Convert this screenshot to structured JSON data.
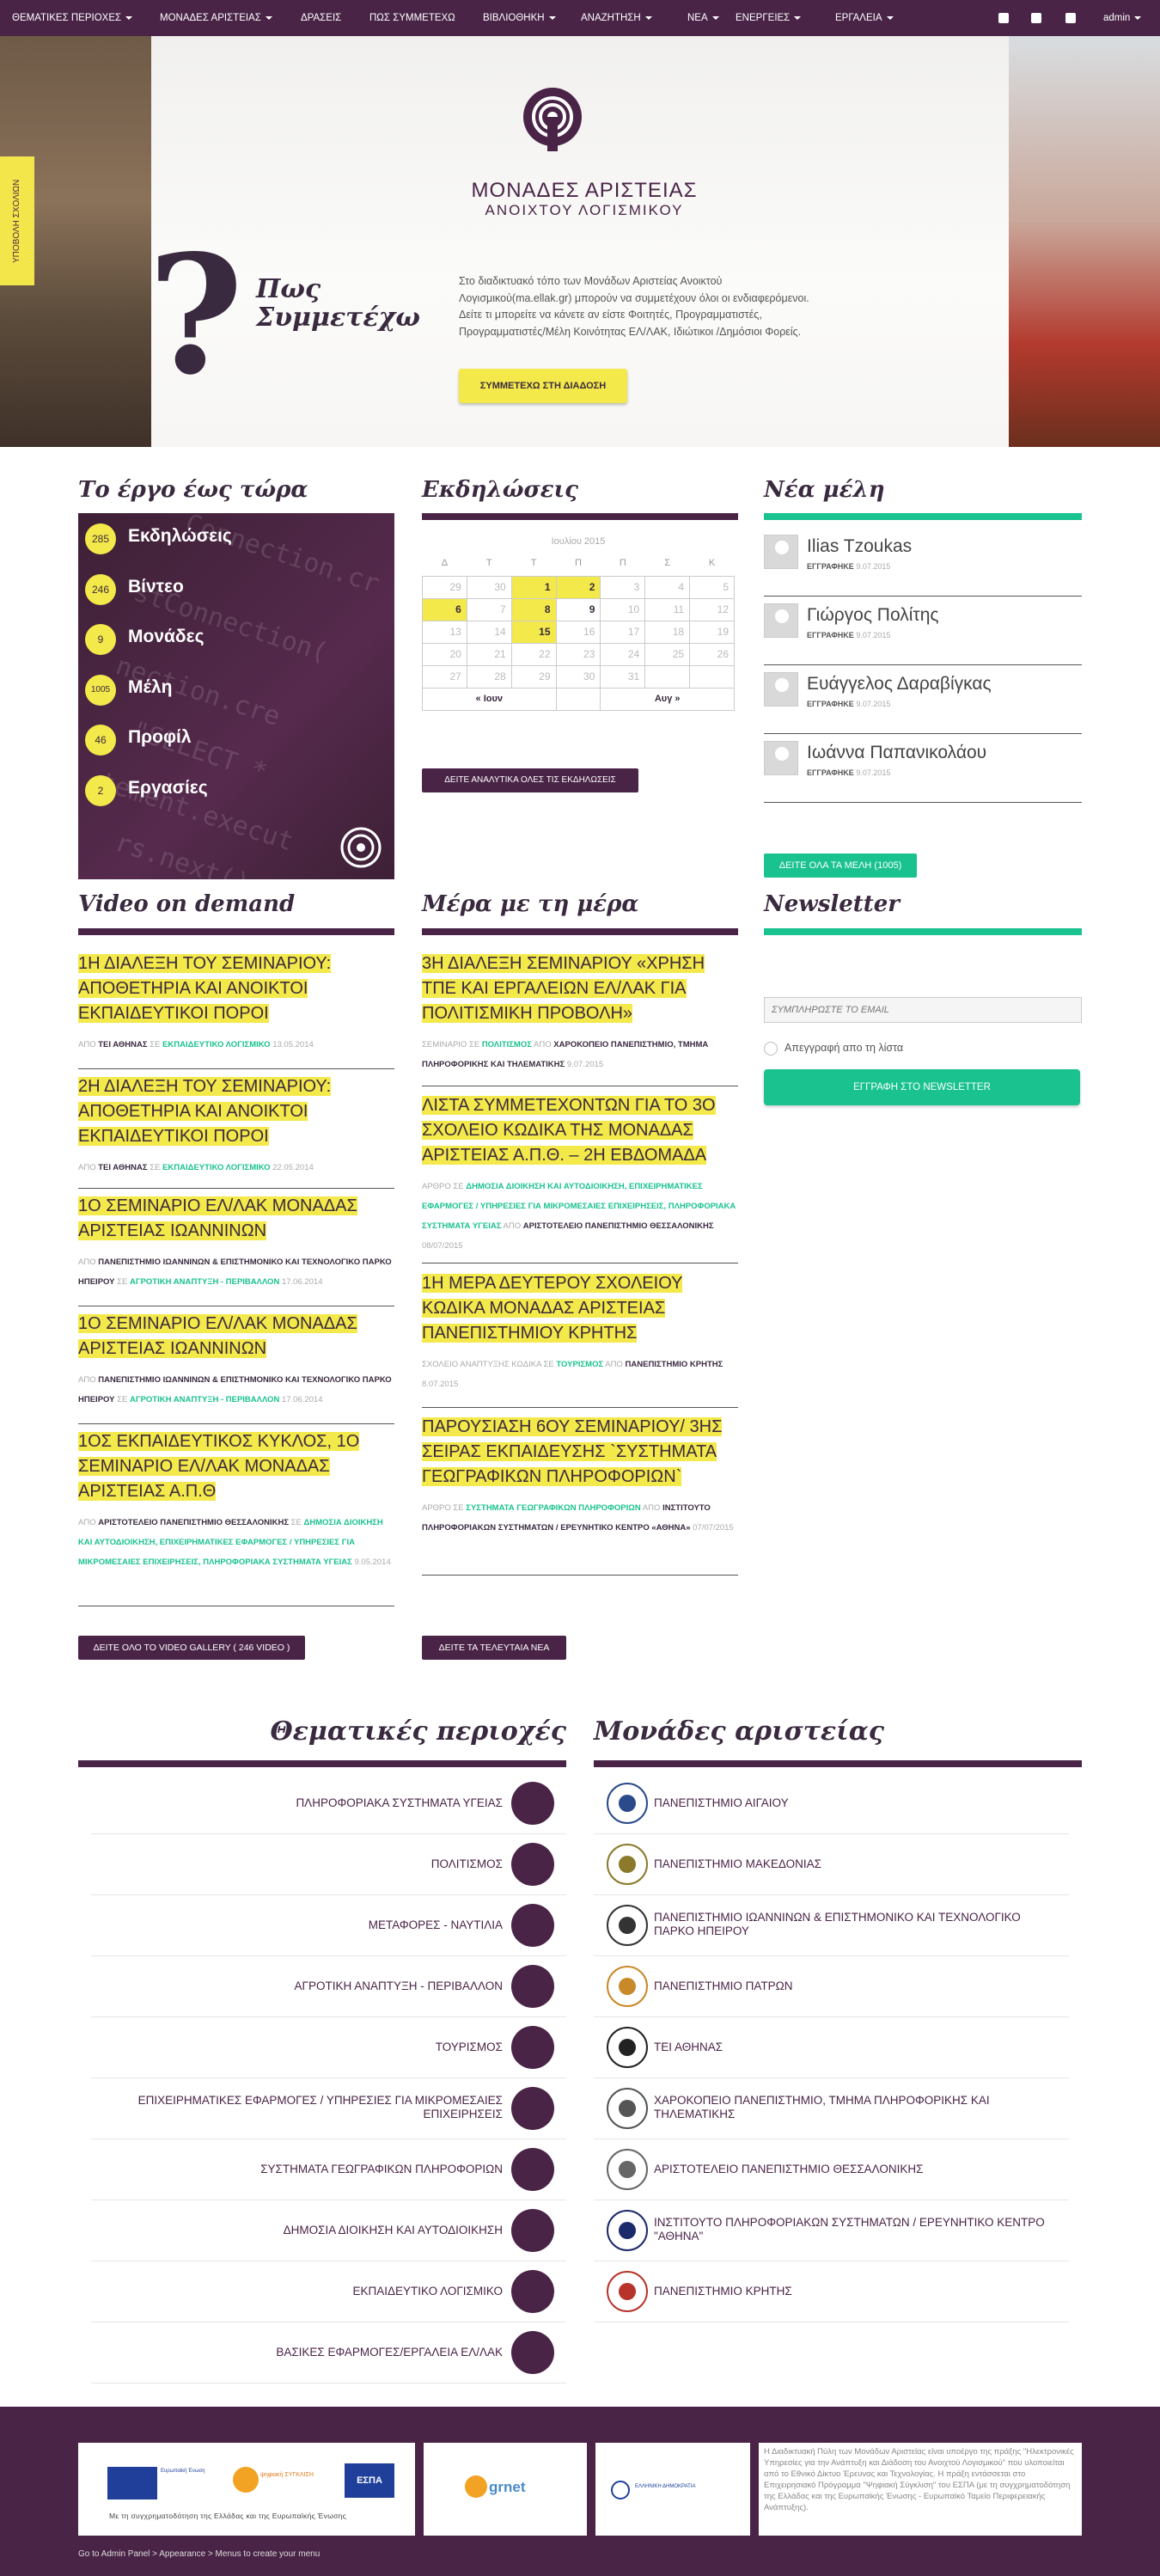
{
  "nav": {
    "items": [
      {
        "label": "ΘΕΜΑΤΙΚΕΣ ΠΕΡΙΟΧΕΣ",
        "dropdown": true
      },
      {
        "label": "ΜΟΝΑΔΕΣ ΑΡΙΣΤΕΙΑΣ",
        "dropdown": true
      },
      {
        "label": "ΔΡΑΣΕΙΣ",
        "dropdown": false
      },
      {
        "label": "ΠΩΣ ΣΥΜΜΕΤΕΧΩ",
        "dropdown": false
      },
      {
        "label": "ΒΙΒΛΙΟΘΗΚΗ",
        "dropdown": true
      },
      {
        "label": "ΑΝΑΖΗΤΗΣΗ",
        "dropdown": true
      },
      {
        "label": "ΝΕΑ",
        "dropdown": true
      },
      {
        "label": "ΕΝΕΡΓΕΙΕΣ",
        "dropdown": true
      },
      {
        "label": "ΕΡΓΑΛΕΙΑ",
        "dropdown": true
      }
    ],
    "social_icons": [
      "facebook-icon",
      "twitter-icon",
      "rss-icon"
    ],
    "user": "admin"
  },
  "hero": {
    "side_tab": "ΥΠΟΒΟΛΗ ΣΧΟΛΙΩΝ",
    "logo_line1": "ΜΟΝΑΔΕΣ ΑΡΙΣΤΕΙΑΣ",
    "logo_line2": "ΑΝΟΙΧΤΟΥ ΛΟΓΙΣΜΙΚΟΥ",
    "qmark": "?",
    "heading_line1": "Πως",
    "heading_line2": "Συμμετέχω",
    "desc_lines": [
      "Στο διαδικτυακό τόπο των Μονάδων Αριστείας Ανοικτού",
      "Λογισμικού(ma.ellak.gr) μπορούν να συμμετέχουν όλοι οι ενδιαφερόμενοι.",
      "Δείτε τι μπορείτε να κάνετε αν είστε Φοιτητές, Προγραμματιστές,",
      "Προγραμματιστές/Μέλη Κοινότητας ΕΛ/ΛΑΚ, Ιδιώτικοι /Δημόσιοι Φορείς."
    ],
    "cta": "ΣΥΜΜΕΤΕΧΩ ΣΤΗ ΔΙΑΔΟΣΗ"
  },
  "work": {
    "title": "Το έργο έως τώρα",
    "stats": [
      {
        "count": "285",
        "label": "Εκδηλώσεις"
      },
      {
        "count": "246",
        "label": "Βίντεο"
      },
      {
        "count": "9",
        "label": "Μονάδες"
      },
      {
        "count": "1005",
        "label": "Μέλη"
      },
      {
        "count": "46",
        "label": "Προφίλ"
      },
      {
        "count": "2",
        "label": "Εργασίες"
      }
    ]
  },
  "events": {
    "title": "Εκδηλώσεις",
    "month": "Ιουλίου 2015",
    "weekdays": [
      "Δ",
      "Τ",
      "Τ",
      "Π",
      "Π",
      "Σ",
      "Κ"
    ],
    "weeks": [
      [
        {
          "d": "29",
          "s": "muted"
        },
        {
          "d": "30",
          "s": "muted"
        },
        {
          "d": "1",
          "s": "hl"
        },
        {
          "d": "2",
          "s": "hl"
        },
        {
          "d": "3",
          "s": "muted"
        },
        {
          "d": "4",
          "s": "muted"
        },
        {
          "d": "5",
          "s": "muted"
        }
      ],
      [
        {
          "d": "6",
          "s": "hl"
        },
        {
          "d": "7",
          "s": "muted"
        },
        {
          "d": "8",
          "s": "hl"
        },
        {
          "d": "9",
          "s": "act"
        },
        {
          "d": "10",
          "s": "muted"
        },
        {
          "d": "11",
          "s": "muted"
        },
        {
          "d": "12",
          "s": "muted"
        }
      ],
      [
        {
          "d": "13",
          "s": "muted"
        },
        {
          "d": "14",
          "s": "muted"
        },
        {
          "d": "15",
          "s": "hl"
        },
        {
          "d": "16",
          "s": "muted"
        },
        {
          "d": "17",
          "s": "muted"
        },
        {
          "d": "18",
          "s": "muted"
        },
        {
          "d": "19",
          "s": "muted"
        }
      ],
      [
        {
          "d": "20",
          "s": "muted"
        },
        {
          "d": "21",
          "s": "muted"
        },
        {
          "d": "22",
          "s": "muted"
        },
        {
          "d": "23",
          "s": "muted"
        },
        {
          "d": "24",
          "s": "muted"
        },
        {
          "d": "25",
          "s": "muted"
        },
        {
          "d": "26",
          "s": "muted"
        }
      ],
      [
        {
          "d": "27",
          "s": "muted"
        },
        {
          "d": "28",
          "s": "muted"
        },
        {
          "d": "29",
          "s": "muted"
        },
        {
          "d": "30",
          "s": "muted"
        },
        {
          "d": "31",
          "s": "muted"
        },
        {
          "d": "",
          "s": "muted"
        },
        {
          "d": "",
          "s": "muted"
        }
      ]
    ],
    "prev": "« Ιουν",
    "next": "Αυγ »",
    "all_button": "ΔΕΙΤΕ ΑΝΑΛΥΤΙΚΑ ΟΛΕΣ ΤΙΣ ΕΚΔΗΛΩΣΕΙΣ"
  },
  "members": {
    "title": "Νέα μέλη",
    "list": [
      {
        "name": "Ilias Tzoukas",
        "label": "ΕΓΓΡΑΦΗΚΕ",
        "date": "9.07.2015"
      },
      {
        "name": "Γιώργος Πολίτης",
        "label": "ΕΓΓΡΑΦΗΚΕ",
        "date": "9.07.2015"
      },
      {
        "name": "Ευάγγελος Δαραβίγκας",
        "label": "ΕΓΓΡΑΦΗΚΕ",
        "date": "9.07.2015"
      },
      {
        "name": "Ιωάννα Παπανικολάου",
        "label": "ΕΓΓΡΑΦΗΚΕ",
        "date": "9.07.2015"
      }
    ],
    "all_button": "ΔΕΙΤΕ ΟΛΑ ΤΑ ΜΕΛΗ (1005)"
  },
  "video": {
    "title": "Video on demand",
    "posts": [
      {
        "lines": [
          "1Η ΔΙΑΛΕΞΗ ΤΟΥ ΣΕΜΙΝΑΡΙΟΥ:",
          "ΑΠΟΘΕΤΗΡΙΑ ΚΑΙ ΑΝΟΙΚΤΟΙ",
          "ΕΚΠΑΙΔΕΥΤΙΚΟΙ ΠΟΡΟΙ"
        ],
        "meta": [
          "ΑΠΟ ",
          "ΤΕΙ ΑΘΗΝΑΣ",
          " ΣΕ ",
          "ΕΚΠΑΙΔΕΥΤΙΚΟ ΛΟΓΙΣΜΙΚΟ",
          " 13.05.2014"
        ]
      },
      {
        "lines": [
          "2Η ΔΙΑΛΕΞΗ ΤΟΥ ΣΕΜΙΝΑΡΙΟΥ:",
          "ΑΠΟΘΕΤΗΡΙΑ ΚΑΙ ΑΝΟΙΚΤΟΙ",
          "ΕΚΠΑΙΔΕΥΤΙΚΟΙ ΠΟΡΟΙ"
        ],
        "meta": [
          "ΑΠΟ ",
          "ΤΕΙ ΑΘΗΝΑΣ",
          " ΣΕ ",
          "ΕΚΠΑΙΔΕΥΤΙΚΟ ΛΟΓΙΣΜΙΚΟ",
          " 22.05.2014"
        ]
      },
      {
        "lines": [
          "1Ο ΣΕΜΙΝΑΡΙΟ ΕΛ/ΛΑΚ ΜΟΝΑΔΑΣ",
          "ΑΡΙΣΤΕΙΑΣ ΙΩΑΝΝΙΝΩΝ"
        ],
        "meta": [
          "ΑΠΟ ",
          "ΠΑΝΕΠΙΣΤΗΜΙΟ ΙΩΑΝΝΙΝΩΝ & ΕΠΙΣΤΗΜΟΝΙΚΟ ΚΑΙ ΤΕΧΝΟΛΟΓΙΚΟ ΠΑΡΚΟ ΗΠΕΙΡΟΥ",
          " ΣΕ ",
          "ΑΓΡΟΤΙΚΗ ΑΝΑΠΤΥΞΗ - ΠΕΡΙΒΑΛΛΟΝ",
          " 17.06.2014"
        ]
      },
      {
        "lines": [
          "1Ο ΣΕΜΙΝΑΡΙΟ ΕΛ/ΛΑΚ ΜΟΝΑΔΑΣ",
          "ΑΡΙΣΤΕΙΑΣ ΙΩΑΝΝΙΝΩΝ"
        ],
        "meta": [
          "ΑΠΟ ",
          "ΠΑΝΕΠΙΣΤΗΜΙΟ ΙΩΑΝΝΙΝΩΝ & ΕΠΙΣΤΗΜΟΝΙΚΟ ΚΑΙ ΤΕΧΝΟΛΟΓΙΚΟ ΠΑΡΚΟ ΗΠΕΙΡΟΥ",
          " ΣΕ ",
          "ΑΓΡΟΤΙΚΗ ΑΝΑΠΤΥΞΗ - ΠΕΡΙΒΑΛΛΟΝ",
          " 17.06.2014"
        ]
      },
      {
        "lines": [
          "1ΟΣ ΕΚΠΑΙΔΕΥΤΙΚΟΣ ΚΥΚΛΟΣ, 1Ο",
          "ΣΕΜΙΝΑΡΙΟ ΕΛ/ΛΑΚ ΜΟΝΑΔΑΣ",
          "ΑΡΙΣΤΕΙΑΣ Α.Π.Θ"
        ],
        "meta": [
          "ΑΠΟ ",
          "ΑΡΙΣΤΟΤΕΛΕΙΟ ΠΑΝΕΠΙΣΤΗΜΙΟ ΘΕΣΣΑΛΟΝΙΚΗΣ",
          " ΣΕ ",
          "ΔΗΜΟΣΙΑ ΔΙΟΙΚΗΣΗ ΚΑΙ ΑΥΤΟΔΙΟΙΚΗΣΗ, ΕΠΙΧΕΙΡΗΜΑΤΙΚΕΣ ΕΦΑΡΜΟΓΕΣ / ΥΠΗΡΕΣΙΕΣ ΓΙΑ ΜΙΚΡΟΜΕΣΑΙΕΣ ΕΠΙΧΕΙΡΗΣΕΙΣ, ΠΛΗΡΟΦΟΡΙΑΚΑ ΣΥΣΤΗΜΑΤΑ ΥΓΕΙΑΣ",
          " 9.05.2014"
        ]
      }
    ],
    "all_button": "ΔΕΙΤΕ ΟΛΟ ΤΟ VIDEO GALLERY ( 246 VIDEO )"
  },
  "daily": {
    "title": "Μέρα με τη μέρα",
    "posts": [
      {
        "lines": [
          "3Η ΔΙΑΛΕΞΗ ΣΕΜΙΝΑΡΙΟΥ «ΧΡΗΣΗ",
          "ΤΠΕ ΚΑΙ ΕΡΓΑΛΕΙΩΝ ΕΛ/ΛΑΚ ΓΙΑ",
          "ΠΟΛΙΤΙΣΜΙΚΗ ΠΡΟΒΟΛΗ»"
        ],
        "meta": [
          "ΣΕΜΙΝΑΡΙΟ ΣΕ ",
          "ΠΟΛΙΤΙΣΜΟΣ",
          " ΑΠΟ ",
          "ΧΑΡΟΚΟΠΕΙΟ ΠΑΝΕΠΙΣΤΗΜΙΟ, ΤΜΗΜΑ ΠΛΗΡΟΦΟΡΙΚΗΣ ΚΑΙ ΤΗΛΕΜΑΤΙΚΗΣ",
          " 9.07.2015"
        ]
      },
      {
        "lines": [
          "ΛΙΣΤΑ ΣΥΜΜΕΤΕΧΟΝΤΩΝ ΓΙΑ ΤΟ 3Ο",
          "ΣΧΟΛΕΙΟ ΚΩΔΙΚΑ ΤΗΣ ΜΟΝΑΔΑΣ",
          "ΑΡΙΣΤΕΙΑΣ Α.Π.Θ. – 2Η ΕΒΔΟΜΑΔΑ"
        ],
        "meta": [
          "ΑΡΘΡΟ ΣΕ ",
          "ΔΗΜΟΣΙΑ ΔΙΟΙΚΗΣΗ ΚΑΙ ΑΥΤΟΔΙΟΙΚΗΣΗ, ΕΠΙΧΕΙΡΗΜΑΤΙΚΕΣ ΕΦΑΡΜΟΓΕΣ / ΥΠΗΡΕΣΙΕΣ ΓΙΑ ΜΙΚΡΟΜΕΣΑΙΕΣ ΕΠΙΧΕΙΡΗΣΕΙΣ, ΠΛΗΡΟΦΟΡΙΑΚΑ ΣΥΣΤΗΜΑΤΑ ΥΓΕΙΑΣ",
          " ΑΠΟ ",
          "ΑΡΙΣΤΟΤΕΛΕΙΟ ΠΑΝΕΠΙΣΤΗΜΙΟ ΘΕΣΣΑΛΟΝΙΚΗΣ",
          " 08/07/2015"
        ]
      },
      {
        "lines": [
          "1Η ΜΕΡΑ ΔΕΥΤΕΡΟΥ ΣΧΟΛΕΙΟΥ",
          "ΚΩΔΙΚΑ ΜΟΝΑΔΑΣ ΑΡΙΣΤΕΙΑΣ",
          "ΠΑΝΕΠΙΣΤΗΜΙΟΥ ΚΡΗΤΗΣ"
        ],
        "meta": [
          "ΣΧΟΛΕΙΟ ΑΝΑΠΤΥΞΗΣ ΚΩΔΙΚΑ ΣΕ ",
          "ΤΟΥΡΙΣΜΟΣ",
          " ΑΠΟ ",
          "ΠΑΝΕΠΙΣΤΗΜΙΟ ΚΡΗΤΗΣ",
          " 8.07.2015"
        ]
      },
      {
        "lines": [
          "ΠΑΡΟΥΣΙΑΣΗ 6ΟΥ ΣΕΜΙΝΑΡΙΟΥ/ 3ΗΣ",
          "ΣΕΙΡΑΣ ΕΚΠΑΙΔΕΥΣΗΣ `ΣΥΣΤΗΜΑΤΑ",
          "ΓΕΩΓΡΑΦΙΚΩΝ ΠΛΗΡΟΦΟΡΙΩΝ`"
        ],
        "meta": [
          "ΑΡΘΡΟ ΣΕ ",
          "ΣΥΣΤΗΜΑΤΑ ΓΕΩΓΡΑΦΙΚΩΝ ΠΛΗΡΟΦΟΡΙΩΝ",
          " ΑΠΟ ",
          "ΙΝΣΤΙΤΟΥΤΟ ΠΛΗΡΟΦΟΡΙΑΚΩΝ ΣΥΣΤΗΜΑΤΩΝ / ΕΡΕΥΝΗΤΙΚΟ ΚΕΝΤΡΟ «ΑΘΗΝΑ»",
          " 07/07/2015"
        ]
      }
    ],
    "all_button": "ΔΕΙΤΕ ΤΑ ΤΕΛΕΥΤΑΙΑ ΝΕΑ"
  },
  "newsletter": {
    "title": "Newsletter",
    "placeholder": "ΣΥΜΠΛΗΡΩΣΤΕ ΤΟ EMAIL",
    "unsubscribe": "Απεγγραφή απο τη λίστα",
    "button": "ΕΓΓΡΑΦΗ ΣΤΟ NEWSLETTER"
  },
  "themes": {
    "title": "Θεματικές περιοχές",
    "items": [
      {
        "label": "ΠΛΗΡΟΦΟΡΙΑΚΑ ΣΥΣΤΗΜΑΤΑ ΥΓΕΙΑΣ",
        "icon": "health-cross-icon"
      },
      {
        "label": "ΠΟΛΙΤΙΣΜΟΣ",
        "icon": "theater-masks-icon"
      },
      {
        "label": "ΜΕΤΑΦΟΡΕΣ - ΝΑΥΤΙΛΙΑ",
        "icon": "ship-icon"
      },
      {
        "label": "ΑΓΡΟΤΙΚΗ ΑΝΑΠΤΥΞΗ - ΠΕΡΙΒΑΛΛΟΝ",
        "icon": "wheat-icon"
      },
      {
        "label": "ΤΟΥΡΙΣΜΟΣ",
        "icon": "luggage-icon"
      },
      {
        "label": "ΕΠΙΧΕΙΡΗΜΑΤΙΚΕΣ ΕΦΑΡΜΟΓΕΣ / ΥΠΗΡΕΣΙΕΣ ΓΙΑ ΜΙΚΡΟΜΕΣΑΙΕΣ ΕΠΙΧΕΙΡΗΣΕΙΣ",
        "icon": "presentation-icon"
      },
      {
        "label": "ΣΥΣΤΗΜΑΤΑ ΓΕΩΓΡΑΦΙΚΩΝ ΠΛΗΡΟΦΟΡΙΩΝ",
        "icon": "globe-icon"
      },
      {
        "label": "ΔΗΜΟΣΙΑ ΔΙΟΙΚΗΣΗ ΚΑΙ ΑΥΤΟΔΙΟΙΚΗΣΗ",
        "icon": "building-icon"
      },
      {
        "label": "ΕΚΠΑΙΔΕΥΤΙΚΟ ΛΟΓΙΣΜΙΚΟ",
        "icon": "owl-icon"
      },
      {
        "label": "ΒΑΣΙΚΕΣ ΕΦΑΡΜΟΓΕΣ/ΕΡΓΑΛΕΙΑ ΕΛ/ΛΑΚ",
        "icon": "oss-icon"
      }
    ]
  },
  "units": {
    "title": "Μονάδες αριστείας",
    "items": [
      {
        "label": "ΠΑΝΕΠΙΣΤΗΜΙΟ ΑΙΓΑΙΟΥ",
        "color": "#2a4a8a"
      },
      {
        "label": "ΠΑΝΕΠΙΣΤΗΜΙΟ ΜΑΚΕΔΟΝΙΑΣ",
        "color": "#8a7a2a"
      },
      {
        "label": "ΠΑΝΕΠΙΣΤΗΜΙΟ ΙΩΑΝΝΙΝΩΝ & ΕΠΙΣΤΗΜΟΝΙΚΟ ΚΑΙ ΤΕΧΝΟΛΟΓΙΚΟ ΠΑΡΚΟ ΗΠΕΙΡΟΥ",
        "color": "#333333"
      },
      {
        "label": "ΠΑΝΕΠΙΣΤΗΜΙΟ ΠΑΤΡΩΝ",
        "color": "#c8892a"
      },
      {
        "label": "ΤΕΙ ΑΘΗΝΑΣ",
        "color": "#222222"
      },
      {
        "label": "ΧΑΡΟΚΟΠΕΙΟ ΠΑΝΕΠΙΣΤΗΜΙΟ, ΤΜΗΜΑ ΠΛΗΡΟΦΟΡΙΚΗΣ ΚΑΙ ΤΗΛΕΜΑΤΙΚΗΣ",
        "color": "#555555"
      },
      {
        "label": "ΑΡΙΣΤΟΤΕΛΕΙΟ ΠΑΝΕΠΙΣΤΗΜΙΟ ΘΕΣΣΑΛΟΝΙΚΗΣ",
        "color": "#666666"
      },
      {
        "label": "ΙΝΣΤΙΤΟΥΤΟ ΠΛΗΡΟΦΟΡΙΑΚΩΝ ΣΥΣΤΗΜΑΤΩΝ / ΕΡΕΥΝΗΤΙΚΟ ΚΕΝΤΡΟ \"ΑΘΗΝΑ\"",
        "color": "#1a2a6a"
      },
      {
        "label": "ΠΑΝΕΠΙΣΤΗΜΙΟ ΚΡΗΤΗΣ",
        "color": "#b8342a"
      }
    ]
  },
  "footer": {
    "cofinance": "Με τη συγχρηματοδότηση της Ελλάδας και της Ευρωπαϊκής Ένωσης",
    "eu_label": "Ευρωπαϊκή Ένωση",
    "digital_label": "ψηφιακή ΣΥΓΚΛΙΣΗ",
    "espa_label": "ΕΣΠΑ",
    "grnet_label": "grnet",
    "ministry_label": "ΕΛΛΗΝΙΚΗ ΔΗΜΟΚΡΑΤΙΑ",
    "text": "Η Διαδικτυακή Πύλη των Μονάδων Αριστείας είναι υποέργο της πράξης \"Ηλεκτρονικές Υπηρεσίες για την Ανάπτυξη και Διάδοση του Ανοιχτού Λογισμικού\" που υλοποιείται από το Εθνικό Δίκτυο Έρευνας και Τεχνολογίας. Η πράξη εντάσσεται στο Επιχειρησιακό Πρόγραμμα \"Ψηφιακή Σύγκλιση\" του ΕΣΠΑ (με τη συγχρηματοδότηση της Ελλάδας και της Ευρωπαϊκής Ένωσης - Ευρωπαϊκό Ταμείο Περιφερειακής Ανάπτυξης).",
    "admin_hint": "Go to Admin Panel > Appearance > Menus to create your menu"
  },
  "colors": {
    "purple": "#4a2447",
    "yellow": "#f4e94a",
    "green": "#19c28f"
  }
}
